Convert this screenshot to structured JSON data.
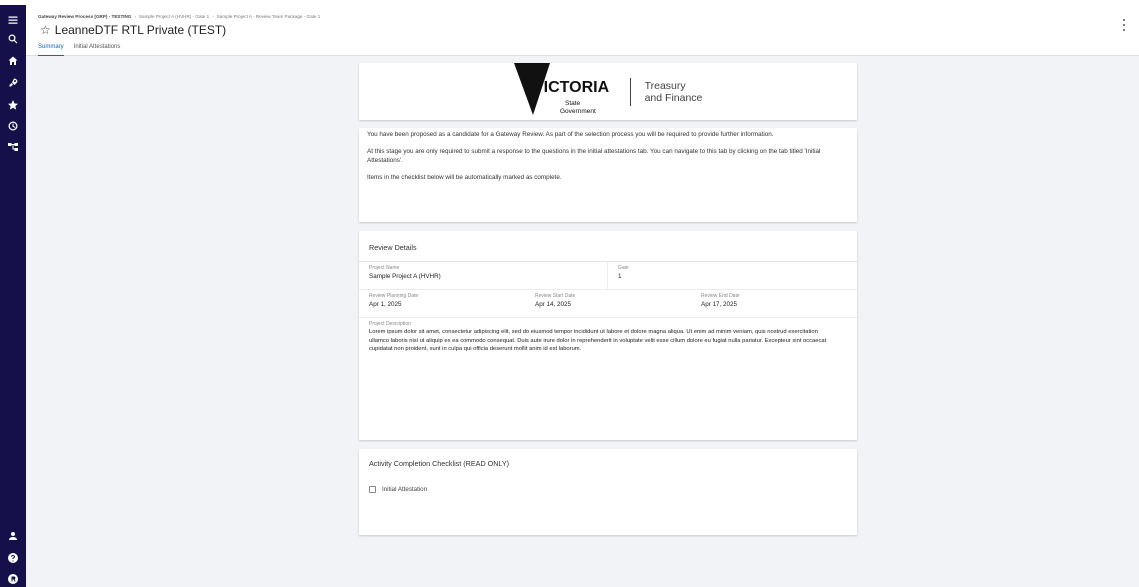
{
  "breadcrumb": [
    "Gateway Review Process (GRP) - TESTING",
    "Sample Project A (HVHR) - Gate 1",
    "Sample Project A - Review Team Package - Gate 1"
  ],
  "header": {
    "star": "☆",
    "title": "LeanneDTF RTL Private (TEST)"
  },
  "tabs": [
    {
      "label": "Summary",
      "active": true
    },
    {
      "label": "Initial Attestations",
      "active": false
    }
  ],
  "logo": {
    "brand_main": "VICTORIA",
    "brand_sub1": "State",
    "brand_sub2": "Government",
    "dept_line1": "Treasury",
    "dept_line2": "and Finance"
  },
  "intro": [
    "You have been proposed as a candidate for a Gateway Review. As part of the selection process you will be required to provide further information.",
    "At this stage you are only required to submit a response to the questions in the initial attestations tab. You can navigate to this tab by clicking on the tab titled 'Initial Attestations'.",
    "Items in the checklist below will be automatically marked as complete."
  ],
  "review_details": {
    "title": "Review Details",
    "project_name_label": "Project Name",
    "project_name": "Sample Project A (HVHR)",
    "gate_label": "Gate",
    "gate": "1",
    "planning_date_label": "Review Planning Date",
    "planning_date": "Apr 1, 2025",
    "start_date_label": "Review Start Date",
    "start_date": "Apr 14, 2025",
    "end_date_label": "Review End Date",
    "end_date": "Apr 17, 2025",
    "description_label": "Project Description",
    "description": "Lorem ipsum dolor sit amet, consectetur adipiscing elit, sed do eiusmod tempor incididunt ut labore et dolore magna aliqua. Ut enim ad minim veniam, quis nostrud exercitation ullamco laboris nisi ut aliquip ex ea commodo consequat. Duis aute irure dolor in reprehenderit in voluptate velit esse cillum dolore eu fugiat nulla pariatur. Excepteur sint occaecat cupidatat non proident, sunt in culpa qui officia deserunt mollit anim id est laborum."
  },
  "checklist": {
    "title": "Activity Completion Checklist (READ ONLY)",
    "items": [
      {
        "label": "Initial Attestation",
        "checked": false
      }
    ]
  },
  "rail_icons": [
    "menu-icon",
    "search-icon",
    "home-icon",
    "rocket-icon",
    "star-icon",
    "history-icon",
    "hierarchy-icon",
    "person-icon",
    "help-icon",
    "logout-icon"
  ],
  "colors": {
    "rail": "#16104a",
    "accent": "#1565c0",
    "background": "#f2f3f7"
  }
}
